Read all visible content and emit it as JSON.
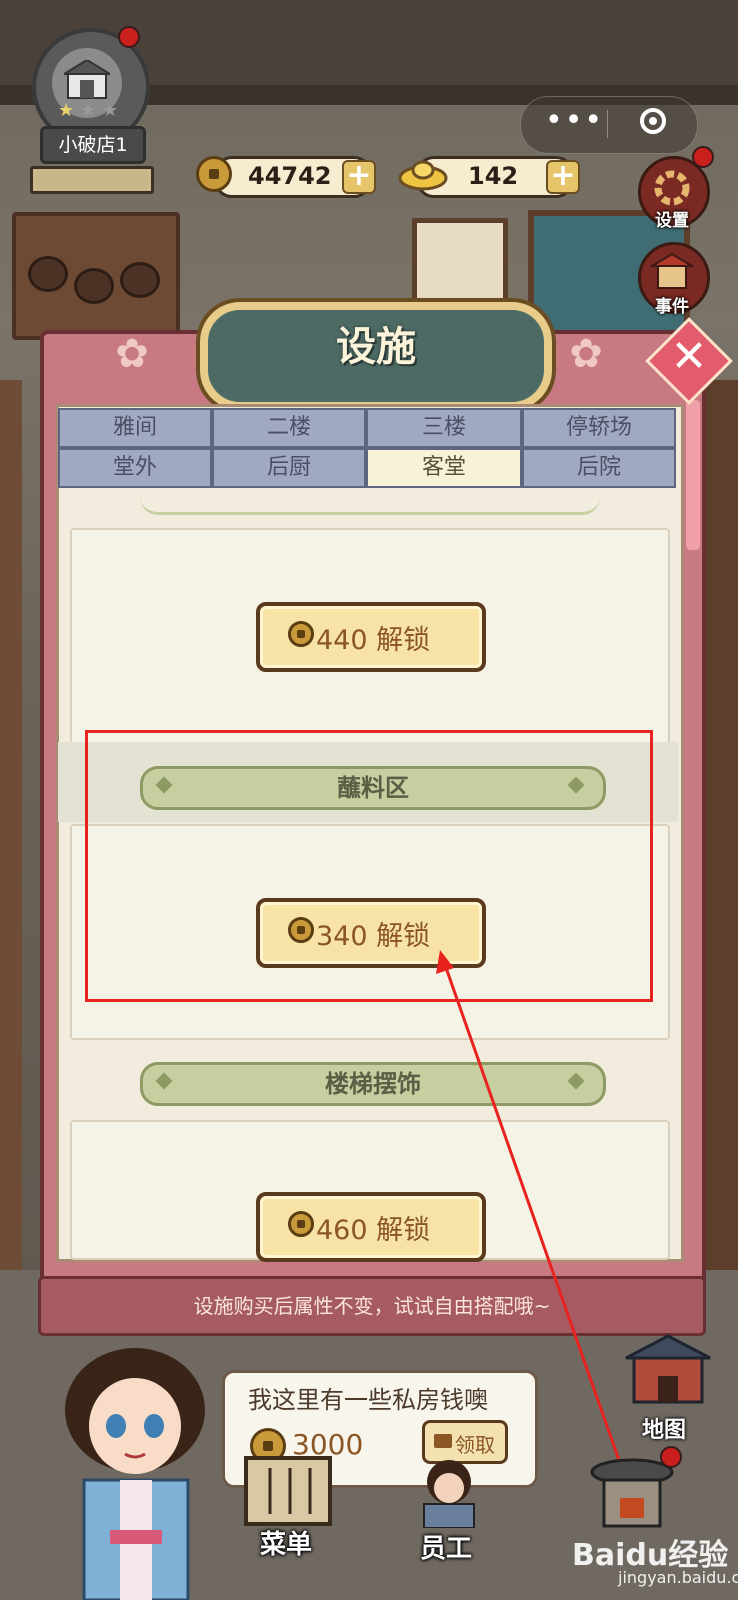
{
  "header": {
    "shop_name": "小破店1",
    "copper_coins": "44742",
    "gold_ingots": "142",
    "plus_label": "+"
  },
  "capsule": {
    "more_label": "•••"
  },
  "right_menu": {
    "settings_label": "设置",
    "events_label": "事件",
    "map_label": "地图"
  },
  "dialog": {
    "title": "设施",
    "close_label": "✕",
    "tabs_row1": [
      "雅间",
      "二楼",
      "三楼",
      "停轿场"
    ],
    "tabs_row2": [
      "堂外",
      "后厨",
      "客堂",
      "后院"
    ],
    "active_tab": "客堂",
    "items": [
      {
        "section": "",
        "unlock_label": "440 解锁"
      },
      {
        "section": "蘸料区",
        "unlock_label": "340 解锁"
      },
      {
        "section": "楼梯摆饰",
        "unlock_label": "460 解锁"
      }
    ],
    "tip": "设施购买后属性不变，试试自由搭配哦~"
  },
  "bubble": {
    "text": "我这里有一些私房钱噢",
    "amount": "3000",
    "claim_label": "领取"
  },
  "bottom_nav": {
    "menu_label": "菜单",
    "staff_label": "员工"
  },
  "watermark": {
    "brand": "Baidu经验",
    "url": "jingyan.baidu.com"
  },
  "colors": {
    "panel": "#c77a82",
    "tab_inactive": "#a0a9c1",
    "tab_active": "#f7f3d8",
    "unlock_button": "#f7e3a6",
    "section_banner": "#c7cea0",
    "highlight": "#e8231f"
  }
}
